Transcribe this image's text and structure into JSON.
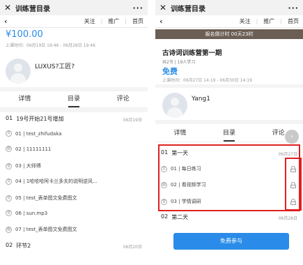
{
  "left": {
    "title": "训练营目录",
    "close": "✕",
    "more": "···",
    "back": "‹",
    "nav": [
      "关注",
      "推广",
      "首页"
    ],
    "price": "¥100.00",
    "time": "上课时间：06月19日 19:46 - 06月28日 19:46",
    "author": "LUXUS?工匠?",
    "tabs": [
      "详情",
      "目录",
      "评论"
    ],
    "sections": [
      {
        "num": "01",
        "title": "19号开始21号增加",
        "date": "06月19日",
        "lessons": [
          {
            "icon": "文",
            "text": "01 | test_zhifudaka"
          },
          {
            "icon": "图",
            "text": "02 | 11111111"
          },
          {
            "icon": "音",
            "text": "03 | 大师傅"
          },
          {
            "icon": "文",
            "text": "04 | 1哈哈哈阿卡兰多夫的说明逆风..."
          },
          {
            "icon": "文",
            "text": "05 | test_表单图文免费图文"
          },
          {
            "icon": "音",
            "text": "06 | sun.mp3"
          },
          {
            "icon": "图",
            "text": "07 | test_表单图文免费图文"
          }
        ]
      },
      {
        "num": "02",
        "title": "环节2",
        "date": "06月20日"
      }
    ]
  },
  "right": {
    "title": "训练营目录",
    "close": "✕",
    "more": "···",
    "back": "‹",
    "nav": [
      "关注",
      "推广",
      "首页"
    ],
    "banner": "报名倒计时 00天23时",
    "course_title": "古诗词训练营第一期",
    "meta": "共2节  |  19人学习",
    "price": "免费",
    "time": "上课时间：06月27日 14:19 - 06月30日 14:19",
    "author": "Yang1",
    "tabs": [
      "详情",
      "目录",
      "评论"
    ],
    "sections": [
      {
        "num": "01",
        "title": "第一天",
        "date": "06月27日",
        "lessons": [
          {
            "icon": "文",
            "text": "01 | 每日练习"
          },
          {
            "icon": "图",
            "text": "02 | 看视频学习"
          },
          {
            "icon": "音",
            "text": "03 | 学情调研"
          }
        ]
      },
      {
        "num": "02",
        "title": "第二天",
        "date": "06月28日"
      }
    ],
    "join_button": "免费参与",
    "scroll_arrow": "›"
  },
  "colors": {
    "accent": "#2a8ce8",
    "highlight": "#e02020"
  }
}
